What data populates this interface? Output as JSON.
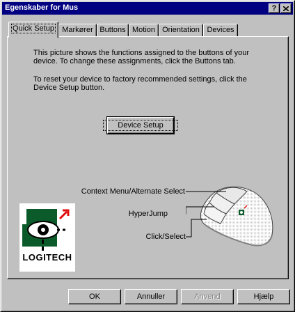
{
  "window": {
    "title": "Egenskaber for Mus"
  },
  "title_buttons": {
    "help_label": "?",
    "close_icon": "close-icon"
  },
  "tabs": [
    {
      "label": "Quick Setup",
      "active": true
    },
    {
      "label": "Markører",
      "active": false
    },
    {
      "label": "Buttons",
      "active": false
    },
    {
      "label": "Motion",
      "active": false
    },
    {
      "label": "Orientation",
      "active": false
    },
    {
      "label": "Devices",
      "active": false
    }
  ],
  "content": {
    "paragraph1": "This picture shows the functions assigned to the buttons of your device.  To change these assignments, click the Buttons tab.",
    "paragraph2": "To reset your device to factory recommended settings, click the Device Setup button.",
    "device_setup_button": "Device Setup"
  },
  "mouse_diagram": {
    "labels": {
      "context_menu": "Context Menu/Alternate Select",
      "hyperjump": "HyperJump",
      "click_select": "Click/Select"
    }
  },
  "logo": {
    "text": "LOGITECH"
  },
  "footer": {
    "ok_label": "OK",
    "cancel_label": "Annuller",
    "apply_label": "Anvend",
    "help_label": "Hjælp"
  },
  "colors": {
    "titlebar": "#000080",
    "face": "#c0c0c0",
    "logo_green": "#0a5a2a",
    "logo_red": "#e01010"
  }
}
